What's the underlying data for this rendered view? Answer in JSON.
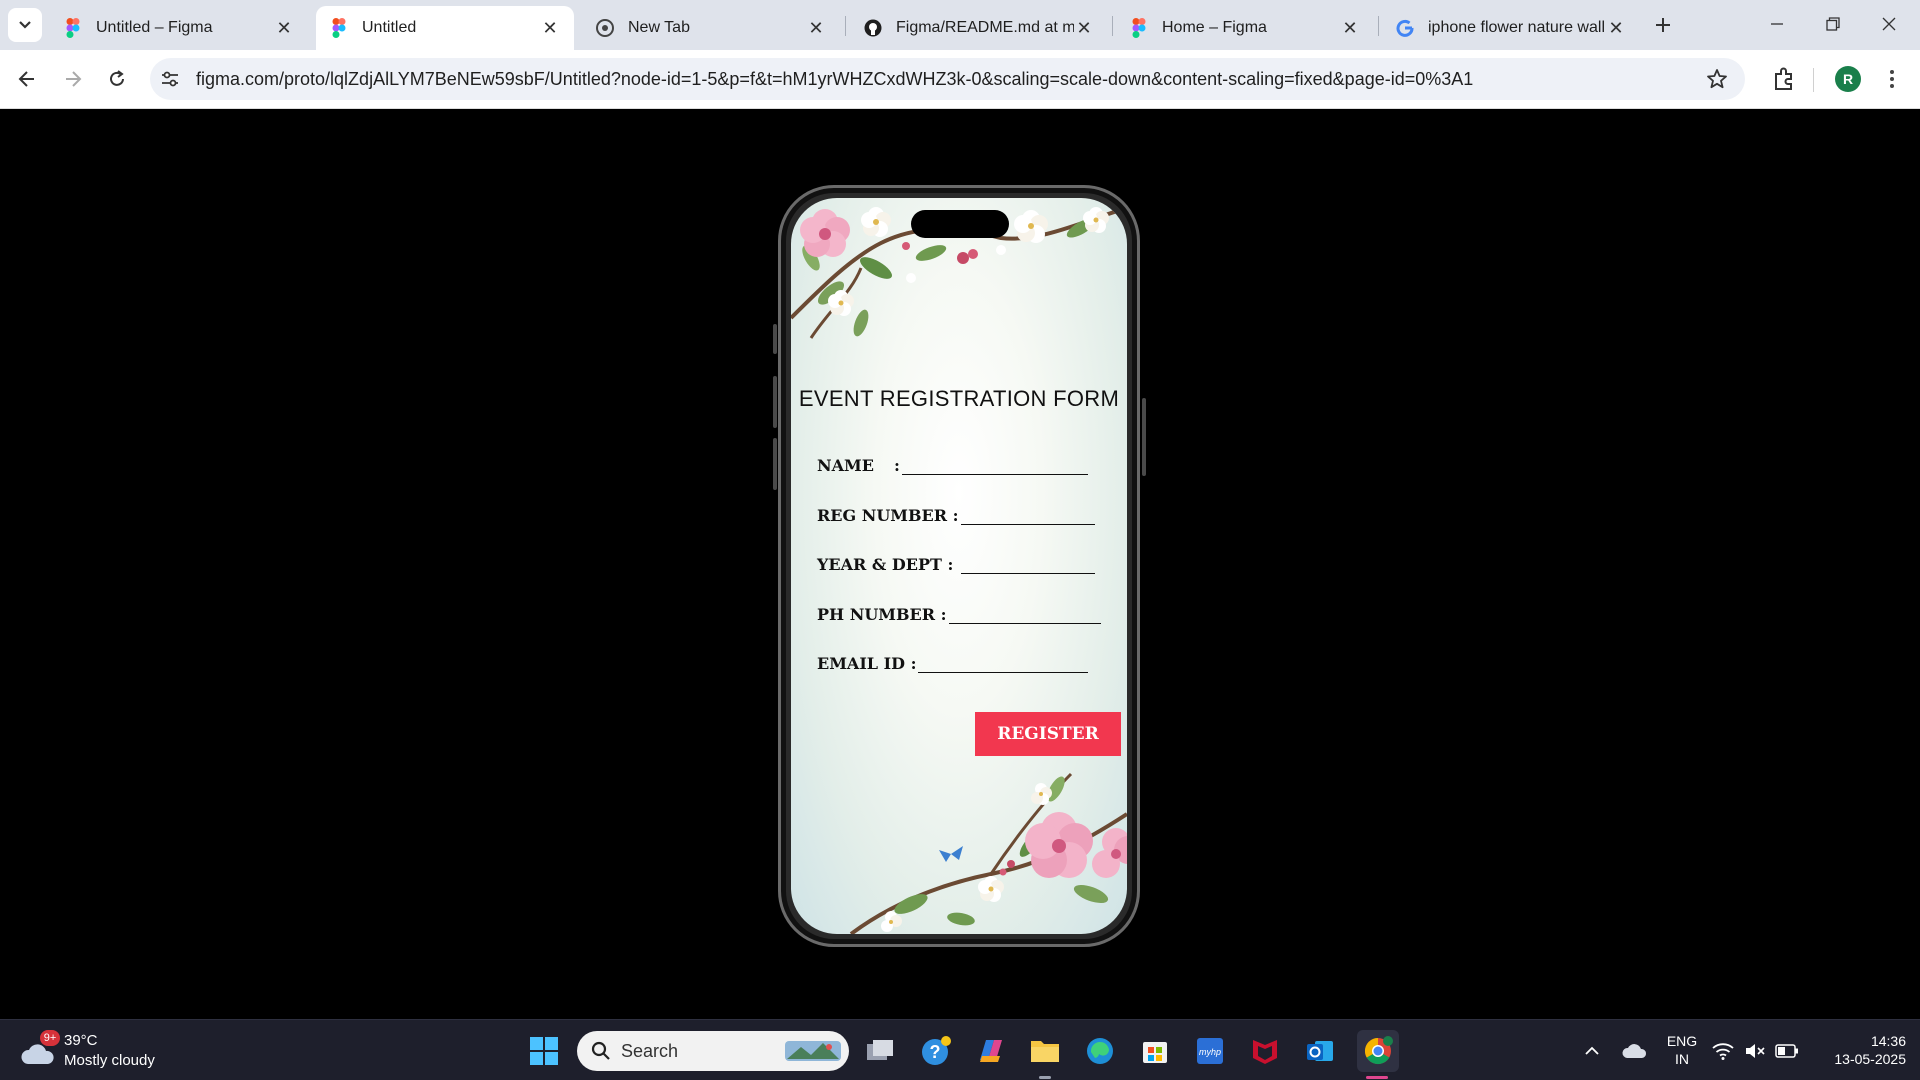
{
  "browser": {
    "tabs": [
      {
        "title": "Untitled – Figma",
        "favicon": "figma-icon",
        "active": false
      },
      {
        "title": "Untitled",
        "favicon": "figma-icon",
        "active": true
      },
      {
        "title": "New Tab",
        "favicon": "chrome-icon",
        "active": false
      },
      {
        "title": "Figma/README.md at main",
        "favicon": "github-icon",
        "active": false
      },
      {
        "title": "Home – Figma",
        "favicon": "figma-icon",
        "active": false
      },
      {
        "title": "iphone flower nature wallpaper",
        "favicon": "google-icon",
        "active": false
      }
    ],
    "url": "figma.com/proto/lqlZdjAlLYM7BeNEw59sbF/Untitled?node-id=1-5&p=f&t=hM1yrWHZCxdWHZ3k-0&scaling=scale-down&content-scaling=fixed&page-id=0%3A1",
    "profile_initial": "R"
  },
  "prototype": {
    "form_title": "EVENT REGISTRATION FORM",
    "fields": [
      {
        "label": "NAME",
        "separator": ":"
      },
      {
        "label": "REG NUMBER",
        "separator": ":"
      },
      {
        "label": "YEAR & DEPT",
        "separator": ":"
      },
      {
        "label": "PH NUMBER",
        "separator": ":"
      },
      {
        "label": "EMAIL ID",
        "separator": ":"
      }
    ],
    "register_label": "REGISTER",
    "button_color": "#f2374f"
  },
  "taskbar": {
    "weather_badge": "9+",
    "temperature": "39°C",
    "condition": "Mostly cloudy",
    "search_label": "Search",
    "language": "ENG",
    "region": "IN",
    "time": "14:36",
    "date": "13-05-2025"
  }
}
